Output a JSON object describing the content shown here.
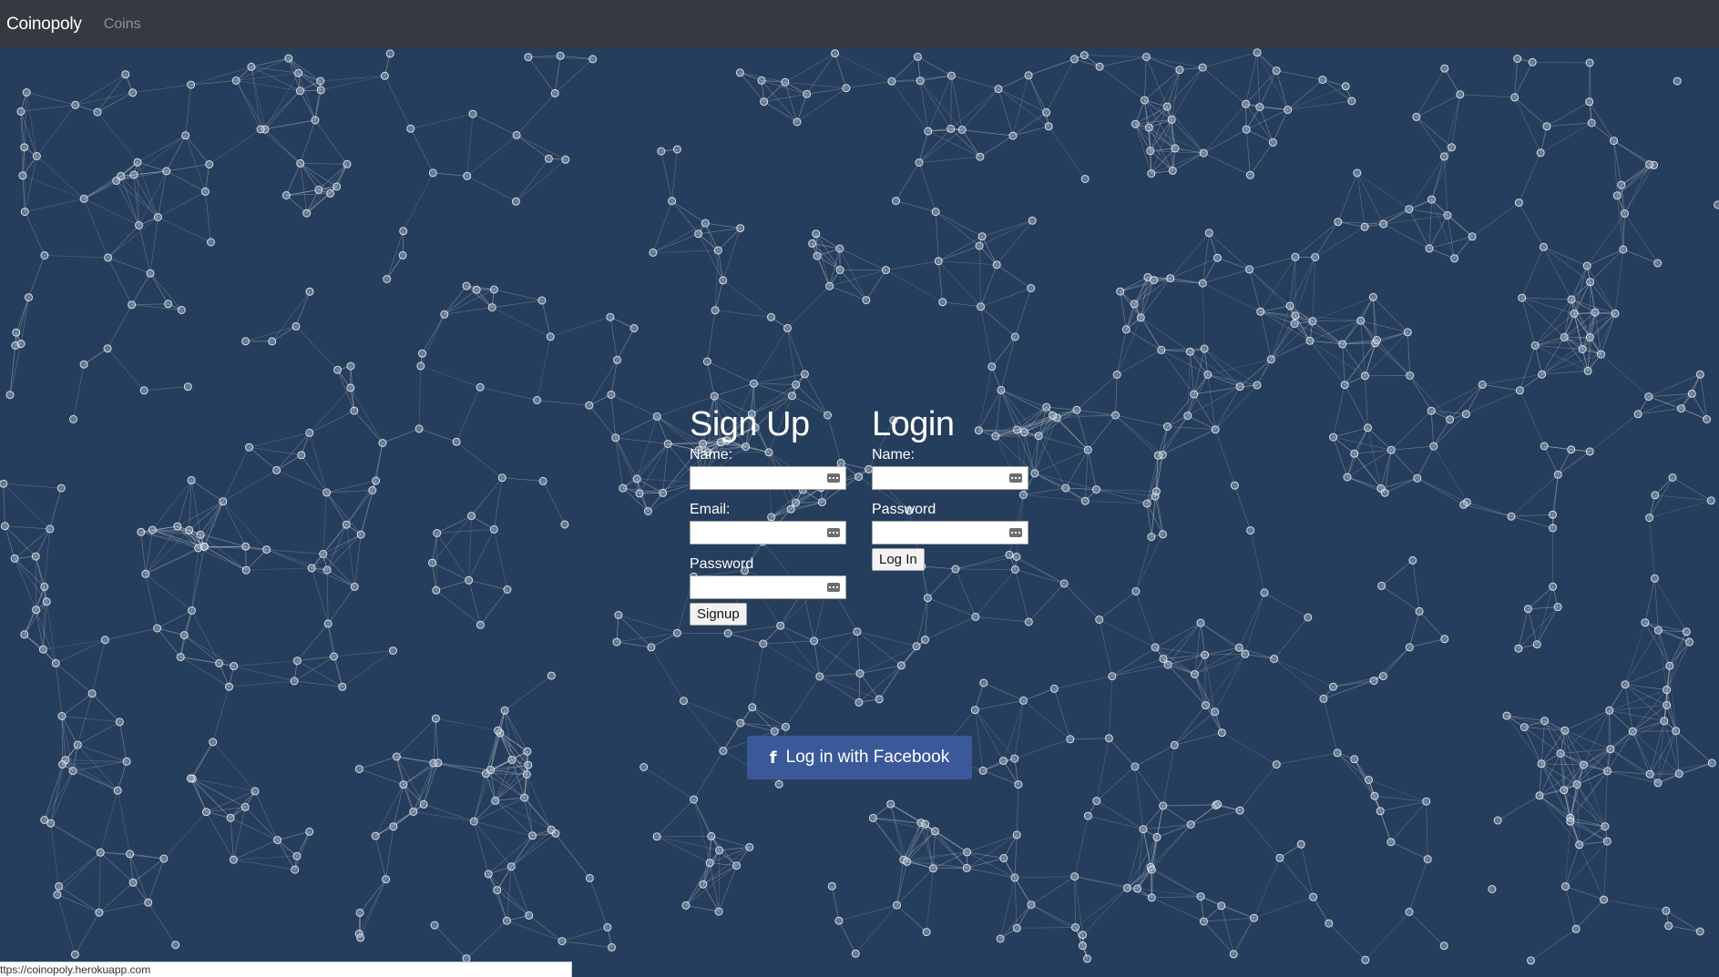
{
  "navbar": {
    "brand": "Coinopoly",
    "links": [
      {
        "label": "Coins"
      }
    ]
  },
  "signup": {
    "title": "Sign Up",
    "name_label": "Name:",
    "email_label": "Email:",
    "password_label": "Password",
    "name_value": "",
    "email_value": "",
    "password_value": "",
    "button_label": "Signup"
  },
  "login": {
    "title": "Login",
    "name_label": "Name:",
    "password_label": "Password",
    "name_value": "",
    "password_value": "",
    "button_label": "Log In"
  },
  "facebook": {
    "button_label": "Log in with Facebook",
    "icon": "facebook-f-icon",
    "color": "#3b5998"
  },
  "status_bar": {
    "url": "ttps://coinopoly.herokuapp.com"
  },
  "background": {
    "color": "#263e5d",
    "pattern": "network-graph"
  }
}
